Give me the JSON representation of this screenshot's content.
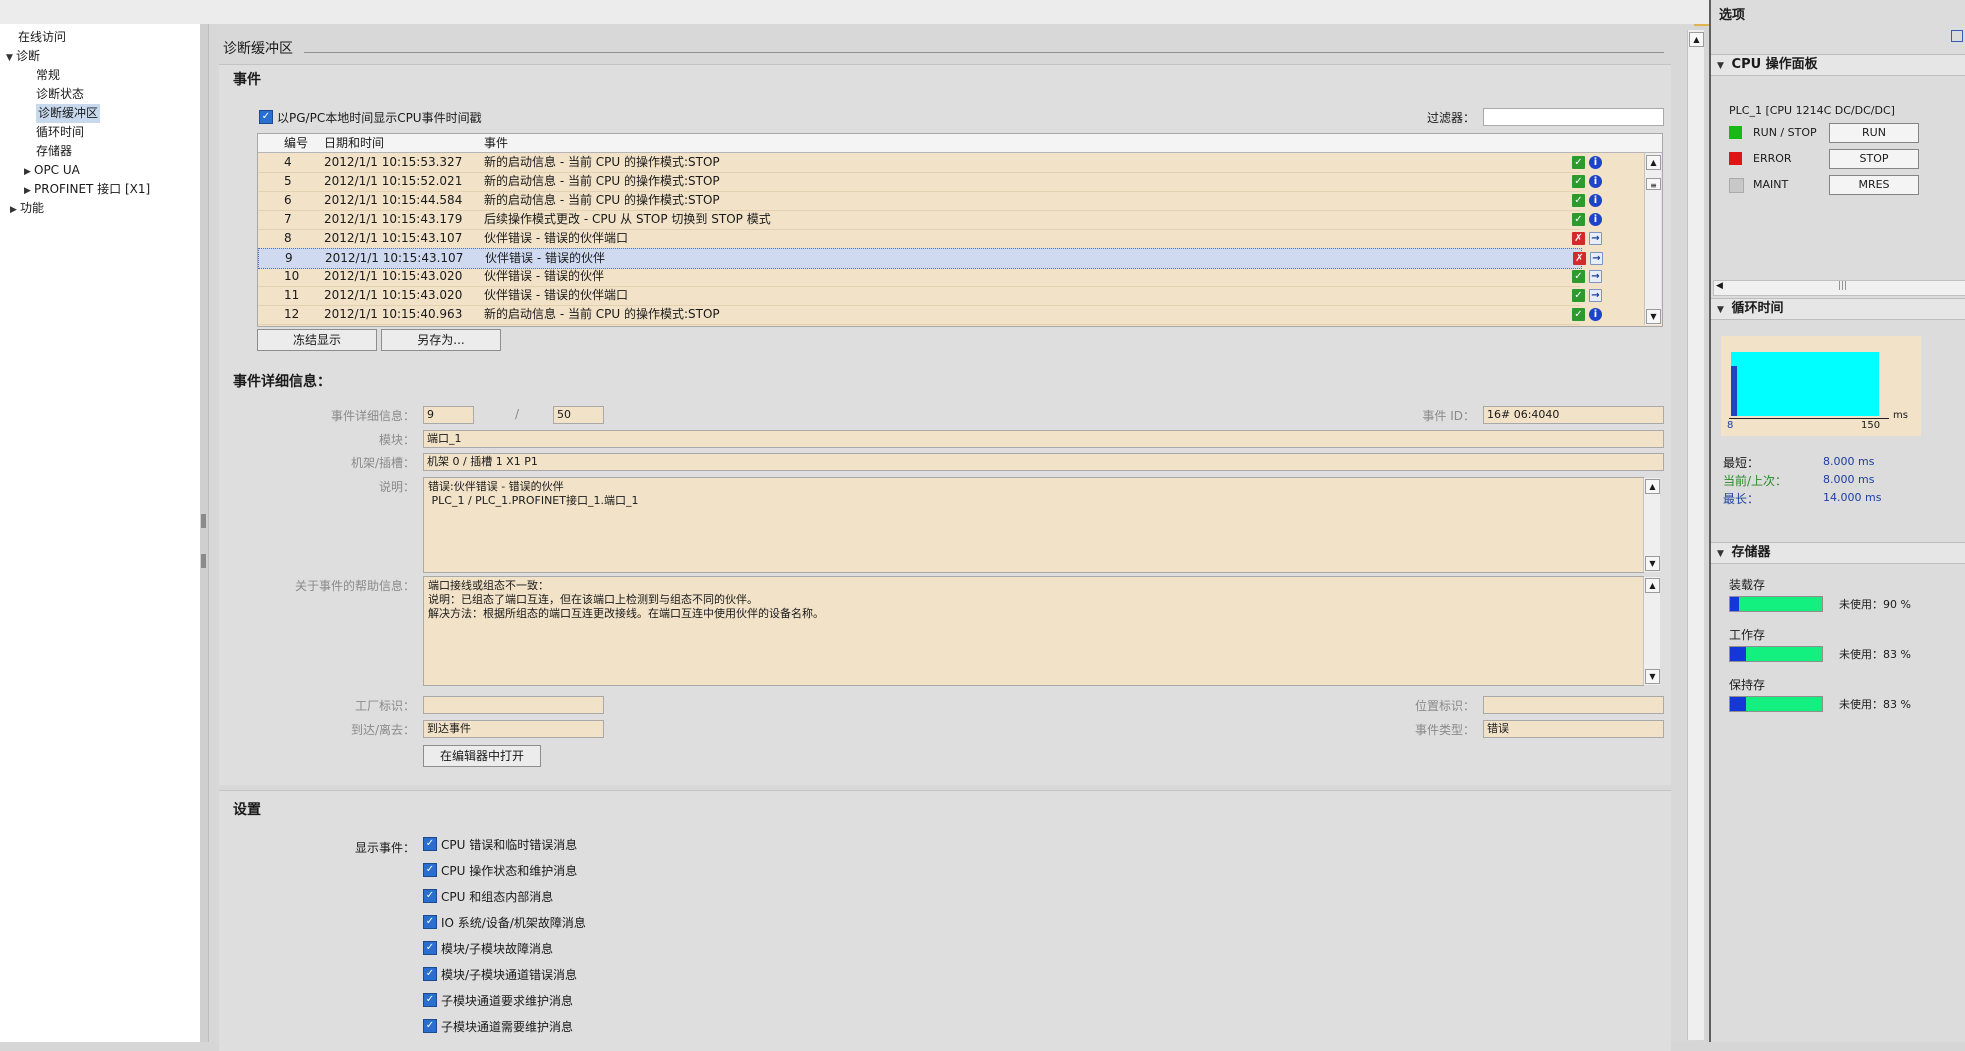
{
  "colors": {
    "accent": "#e2b24e",
    "row_bg": "#f1e2c8",
    "ok": "#2c9a2c",
    "info": "#1d43c6",
    "error": "#d22a2a",
    "run_led": "#18b818",
    "error_led": "#e01414",
    "maint_led": "#c8c8c8",
    "cycle_fill": "#00ffff",
    "mem_used": "#1438d8",
    "mem_free": "#14f080"
  },
  "tree": {
    "online_access": "在线访问",
    "diagnostics": "诊断",
    "general": "常规",
    "diag_status": "诊断状态",
    "diag_buffer": "诊断缓冲区",
    "cycle_time": "循环时间",
    "memory": "存储器",
    "opc_ua": "OPC UA",
    "profinet": "PROFINET 接口 [X1]",
    "functions": "功能"
  },
  "main": {
    "title": "诊断缓冲区",
    "events": {
      "title": "事件",
      "show_local_time_label": "以PG/PC本地时间显示CPU事件时间戳",
      "filter_label": "过滤器：",
      "filter_value": "",
      "columns": [
        "编号",
        "日期和时间",
        "事件"
      ],
      "rows": [
        {
          "no": "4",
          "time": "2012/1/1 10:15:53.327",
          "event": "新的启动信息 - 当前 CPU 的操作模式:STOP",
          "status": "ok",
          "kind": "info"
        },
        {
          "no": "5",
          "time": "2012/1/1 10:15:52.021",
          "event": "新的启动信息 - 当前 CPU 的操作模式:STOP",
          "status": "ok",
          "kind": "info"
        },
        {
          "no": "6",
          "time": "2012/1/1 10:15:44.584",
          "event": "新的启动信息 - 当前 CPU 的操作模式:STOP",
          "status": "ok",
          "kind": "info"
        },
        {
          "no": "7",
          "time": "2012/1/1 10:15:43.179",
          "event": "后续操作模式更改 - CPU 从 STOP 切换到 STOP 模式",
          "status": "ok",
          "kind": "info"
        },
        {
          "no": "8",
          "time": "2012/1/1 10:15:43.107",
          "event": "伙伴错误 - 错误的伙伴端口",
          "status": "error",
          "kind": "arrow"
        },
        {
          "no": "9",
          "time": "2012/1/1 10:15:43.107",
          "event": "伙伴错误 - 错误的伙伴",
          "status": "error",
          "kind": "arrow",
          "selected": true
        },
        {
          "no": "10",
          "time": "2012/1/1 10:15:43.020",
          "event": "伙伴错误 - 错误的伙伴",
          "status": "ok",
          "kind": "arrow"
        },
        {
          "no": "11",
          "time": "2012/1/1 10:15:43.020",
          "event": "伙伴错误 - 错误的伙伴端口",
          "status": "ok",
          "kind": "arrow"
        },
        {
          "no": "12",
          "time": "2012/1/1 10:15:40.963",
          "event": "新的启动信息 - 当前 CPU 的操作模式:STOP",
          "status": "ok",
          "kind": "info"
        }
      ],
      "freeze_button": "冻结显示",
      "save_as_button": "另存为..."
    },
    "details": {
      "title": "事件详细信息：",
      "detail_info_label": "事件详细信息：",
      "detail_current": "9",
      "slash": "/",
      "detail_total": "50",
      "event_id_label": "事件 ID：",
      "event_id": "16# 06:4040",
      "module_label": "模块：",
      "module": "端口_1",
      "rack_label": "机架/插槽：",
      "rack": "机架 0 / 插槽 1 X1 P1",
      "desc_label": "说明：",
      "description": "错误:伙伴错误 - 错误的伙伴\n PLC_1 / PLC_1.PROFINET接口_1.端口_1",
      "help_label": "关于事件的帮助信息：",
      "help": "端口接线或组态不一致：\n说明：已组态了端口互连，但在该端口上检测到与组态不同的伙伴。\n解决方法：根据所组态的端口互连更改接线。在端口互连中使用伙伴的设备名称。",
      "plant_label": "工厂标识：",
      "plant": "",
      "location_label": "位置标识：",
      "location": "",
      "arrive_label": "到达/离去：",
      "arrive": "到达事件",
      "type_label": "事件类型：",
      "type": "错误",
      "open_editor_button": "在编辑器中打开"
    },
    "settings": {
      "title": "设置",
      "show_events_label": "显示事件：",
      "options": [
        "CPU 错误和临时错误消息",
        "CPU 操作状态和维护消息",
        "CPU 和组态内部消息",
        "IO 系统/设备/机架故障消息",
        "模块/子模块故障消息",
        "模块/子模块通道错误消息",
        "子模块通道要求维护消息",
        "子模块通道需要维护消息"
      ]
    }
  },
  "right": {
    "title": "选项",
    "cpu_panel": {
      "title": "CPU 操作面板",
      "plc": "PLC_1 [CPU 1214C DC/DC/DC]",
      "run_stop": "RUN / STOP",
      "error": "ERROR",
      "maint": "MAINT",
      "run_button": "RUN",
      "stop_button": "STOP",
      "mres_button": "MRES"
    },
    "cycle": {
      "title": "循环时间",
      "axis_min": "8",
      "axis_max": "150",
      "unit": "ms",
      "shortest_label": "最短：",
      "shortest": "8.000 ms",
      "current_label": "当前/上次：",
      "current": "8.000 ms",
      "longest_label": "最长：",
      "longest": "14.000 ms",
      "range_min": 8,
      "range_max": 150,
      "fill_to": 150
    },
    "memory": {
      "title": "存储器",
      "items": [
        {
          "name": "装载存",
          "free_label": "未使用：90 %",
          "used_percent": 10
        },
        {
          "name": "工作存",
          "free_label": "未使用：83 %",
          "used_percent": 17
        },
        {
          "name": "保持存",
          "free_label": "未使用：83 %",
          "used_percent": 17
        }
      ]
    }
  }
}
